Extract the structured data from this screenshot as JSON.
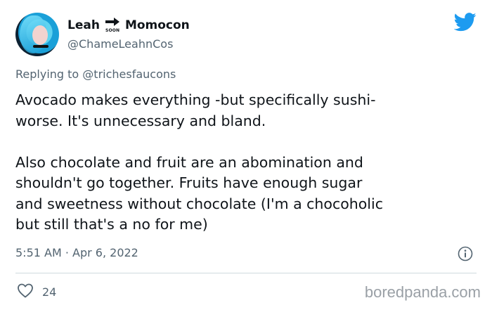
{
  "tweet": {
    "author": {
      "name_part1": "Leah",
      "sign_text": "SOON",
      "name_part2": "Momocon",
      "handle": "@ChameLeahnCos",
      "avatar": "avatar-photo"
    },
    "reply_prefix": "Replying to",
    "reply_to": "@trichesfaucons",
    "paragraphs": [
      "Avocado makes everything -but specifically sushi-\nworse. It's unnecessary and bland.",
      "Also chocolate and fruit are an abomination and\nshouldn't go together. Fruits have enough sugar\nand sweetness without chocolate (I'm a chocoholic\nbut still that's a no for me)"
    ],
    "timestamp": "5:51 AM · Apr 6, 2022",
    "likes": "24"
  },
  "icons": {
    "brand": "twitter-bird-icon",
    "info": "info-icon",
    "like": "heart-icon"
  },
  "colors": {
    "brand": "#1d9bf0",
    "muted": "#536471"
  },
  "watermark": "boredpanda.com"
}
